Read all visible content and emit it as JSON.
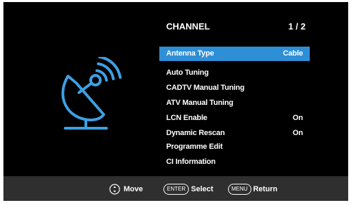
{
  "menu": {
    "title": "CHANNEL",
    "page": "1 / 2",
    "items": [
      {
        "label": "Antenna Type",
        "value": "Cable",
        "selected": true
      },
      {
        "label": "Auto Tuning",
        "value": ""
      },
      {
        "label": "CADTV Manual Tuning",
        "value": ""
      },
      {
        "label": "ATV Manual Tuning",
        "value": ""
      },
      {
        "label": "LCN Enable",
        "value": "On"
      },
      {
        "label": "Dynamic Rescan",
        "value": "On"
      },
      {
        "label": "Programme Edit",
        "value": ""
      },
      {
        "label": "CI Information",
        "value": ""
      }
    ]
  },
  "footer": {
    "move_label": "Move",
    "enter_key": "ENTER",
    "select_label": "Select",
    "menu_key": "MENU",
    "return_label": "Return"
  },
  "colors": {
    "background": "#000000",
    "highlight": "#2f8fd6",
    "icon": "#3ea0e4",
    "footer": "#2f2f2f"
  },
  "icons": {
    "hero": "satellite-dish-icon",
    "move": "dpad-icon"
  }
}
